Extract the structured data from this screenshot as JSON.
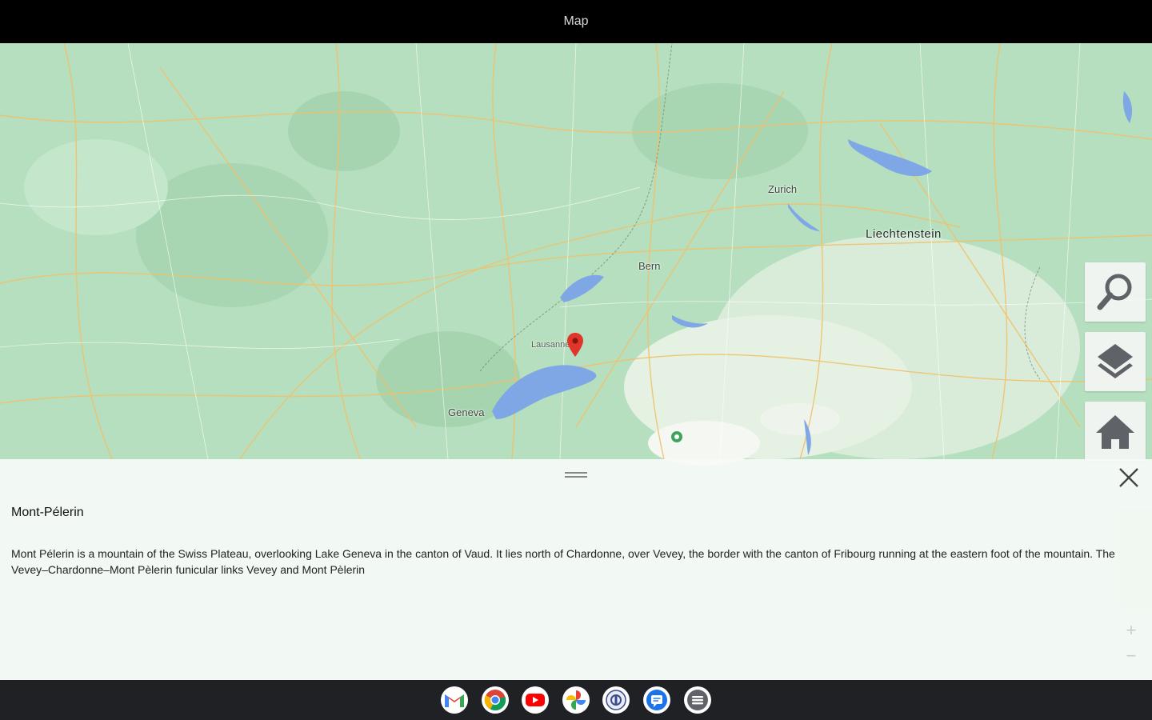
{
  "window": {
    "title": "Map"
  },
  "map": {
    "labels": {
      "liechtenstein": "Liechtenstein",
      "bern": "Bern",
      "zurich": "Zurich",
      "geneva": "Geneva",
      "lausanne": "Lausanne"
    }
  },
  "side_buttons": {
    "search_icon": "search-icon",
    "layers_icon": "layers-icon",
    "home_icon": "home-icon"
  },
  "panel": {
    "title": "Mont-Pélerin",
    "description": "Mont Pélerin is a mountain of the Swiss Plateau, overlooking Lake Geneva in the canton of Vaud. It lies north of Chardonne, over Vevey, the border with the canton of Fribourg running at the eastern foot of the mountain. The Vevey–Chardonne–Mont Pèlerin funicular links Vevey and Mont Pèlerin",
    "zoom_in": "+",
    "zoom_out": "−"
  },
  "shelf": {
    "apps": [
      "gmail-icon",
      "chrome-icon",
      "youtube-icon",
      "photos-icon",
      "app-icon",
      "messages-icon",
      "menu-app-icon"
    ]
  },
  "colors": {
    "map_land": "#b7dfc0",
    "water": "#7fa7e6",
    "pin": "#e0352b",
    "road": "#f2c06a"
  }
}
